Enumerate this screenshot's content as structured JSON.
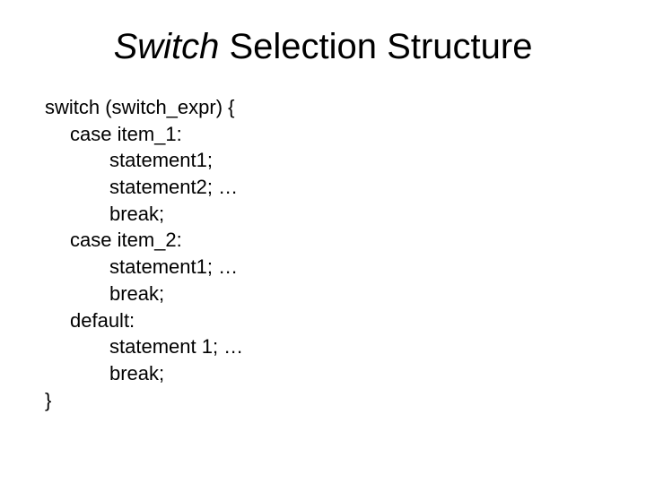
{
  "title_italic": "Switch",
  "title_rest": " Selection Structure",
  "code": {
    "l1": "switch (switch_expr) {",
    "l2": "case item_1:",
    "l3": "statement1;",
    "l4": "statement2; …",
    "l5": "break;",
    "l6": "case item_2:",
    "l7": "statement1; …",
    "l8": "break;",
    "l9": "default:",
    "l10": "statement 1;  …",
    "l11": "break;",
    "l12": "}"
  }
}
